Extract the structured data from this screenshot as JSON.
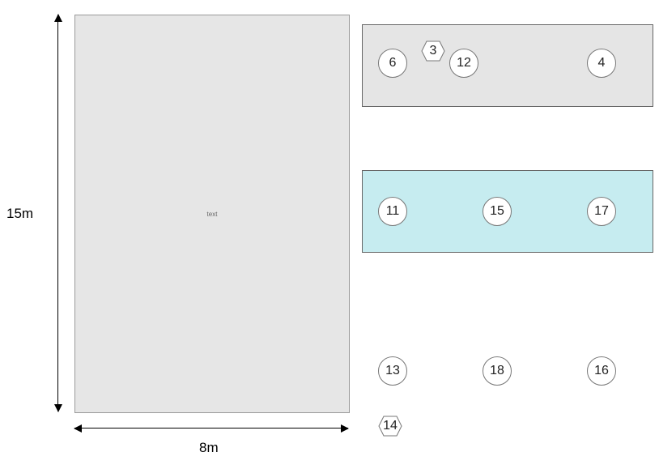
{
  "big_rect": {
    "center_text": "text"
  },
  "dimensions": {
    "height": "15m",
    "width": "8m"
  },
  "top_box_nodes": {
    "c1": "6",
    "h1": "3",
    "c2": "12",
    "c3": "4"
  },
  "mid_box_nodes": {
    "c1": "11",
    "c2": "15",
    "c3": "17"
  },
  "bottom_nodes": {
    "c1": "13",
    "c2": "18",
    "c3": "16"
  },
  "lower_hex": "14"
}
